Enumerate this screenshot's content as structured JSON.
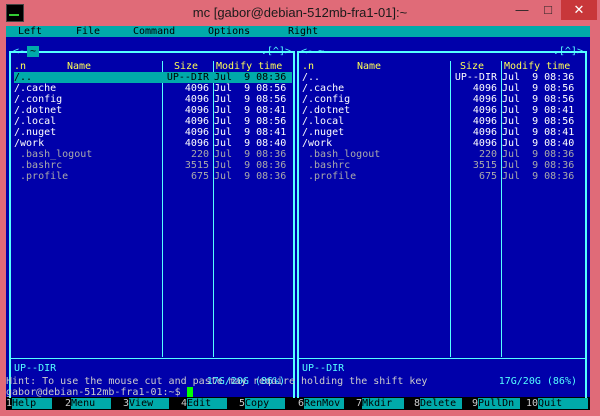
{
  "window": {
    "title": "mc [gabor@debian-512mb-fra1-01]:~",
    "min": "—",
    "max": "□",
    "close": "✕"
  },
  "menu": [
    "Left",
    "File",
    "Command",
    "Options",
    "Right"
  ],
  "left_panel": {
    "path": "~",
    "marker": ".[^]>",
    "cols": {
      "n": ".n",
      "name": "Name",
      "size": "Size",
      "time": "Modify time"
    },
    "rows": [
      {
        "name": "/..",
        "size": "UP--DIR",
        "time": "Jul  9 08:36",
        "sel": true
      },
      {
        "name": "/.cache",
        "size": "4096",
        "time": "Jul  9 08:56"
      },
      {
        "name": "/.config",
        "size": "4096",
        "time": "Jul  9 08:56"
      },
      {
        "name": "/.dotnet",
        "size": "4096",
        "time": "Jul  9 08:41"
      },
      {
        "name": "/.local",
        "size": "4096",
        "time": "Jul  9 08:56"
      },
      {
        "name": "/.nuget",
        "size": "4096",
        "time": "Jul  9 08:41"
      },
      {
        "name": "/work",
        "size": "4096",
        "time": "Jul  9 08:40"
      },
      {
        "name": " .bash_logout",
        "size": "220",
        "time": "Jul  9 08:36",
        "hidden": true
      },
      {
        "name": " .bashrc",
        "size": "3515",
        "time": "Jul  9 08:36",
        "hidden": true
      },
      {
        "name": " .profile",
        "size": "675",
        "time": "Jul  9 08:36",
        "hidden": true
      }
    ],
    "status": "UP--DIR",
    "disk": "17G/20G (86%)"
  },
  "right_panel": {
    "path": "~",
    "marker": ".[^]>",
    "cols": {
      "n": ".n",
      "name": "Name",
      "size": "Size",
      "time": "Modify time"
    },
    "rows": [
      {
        "name": "/..",
        "size": "UP--DIR",
        "time": "Jul  9 08:36"
      },
      {
        "name": "/.cache",
        "size": "4096",
        "time": "Jul  9 08:56"
      },
      {
        "name": "/.config",
        "size": "4096",
        "time": "Jul  9 08:56"
      },
      {
        "name": "/.dotnet",
        "size": "4096",
        "time": "Jul  9 08:41"
      },
      {
        "name": "/.local",
        "size": "4096",
        "time": "Jul  9 08:56"
      },
      {
        "name": "/.nuget",
        "size": "4096",
        "time": "Jul  9 08:41"
      },
      {
        "name": "/work",
        "size": "4096",
        "time": "Jul  9 08:40"
      },
      {
        "name": " .bash_logout",
        "size": "220",
        "time": "Jul  9 08:36",
        "hidden": true
      },
      {
        "name": " .bashrc",
        "size": "3515",
        "time": "Jul  9 08:36",
        "hidden": true
      },
      {
        "name": " .profile",
        "size": "675",
        "time": "Jul  9 08:36",
        "hidden": true
      }
    ],
    "status": "UP--DIR",
    "disk": "17G/20G (86%)"
  },
  "hint": "Hint: To use the mouse cut and paste may require holding the shift key",
  "prompt": "gabor@debian-512mb-fra1-01:~$ ",
  "fkeys": [
    {
      "n": "1",
      "l": "Help"
    },
    {
      "n": "2",
      "l": "Menu"
    },
    {
      "n": "3",
      "l": "View"
    },
    {
      "n": "4",
      "l": "Edit"
    },
    {
      "n": "5",
      "l": "Copy"
    },
    {
      "n": "6",
      "l": "RenMov"
    },
    {
      "n": "7",
      "l": "Mkdir"
    },
    {
      "n": "8",
      "l": "Delete"
    },
    {
      "n": "9",
      "l": "PullDn"
    },
    {
      "n": "10",
      "l": "Quit"
    }
  ]
}
